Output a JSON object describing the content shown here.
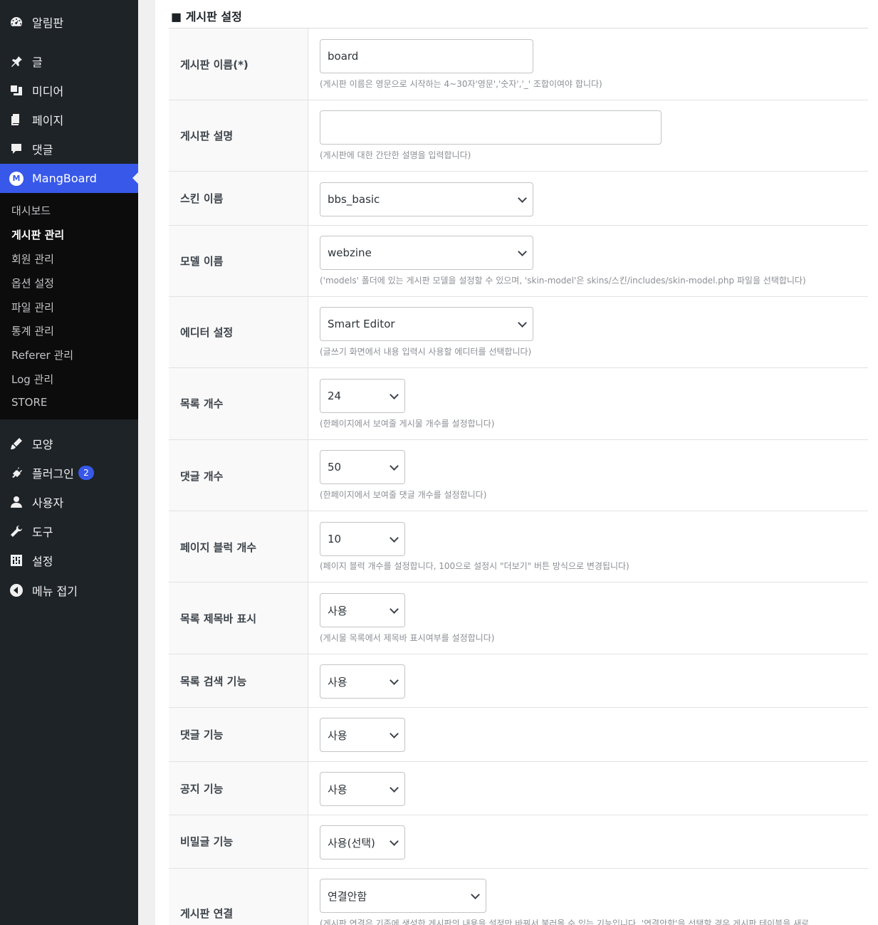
{
  "sidebar": {
    "top_items": [
      {
        "label": "알림판",
        "icon": "dashboard-icon"
      },
      {
        "label": "글",
        "icon": "pin-icon"
      },
      {
        "label": "미디어",
        "icon": "media-icon"
      },
      {
        "label": "페이지",
        "icon": "pages-icon"
      },
      {
        "label": "댓글",
        "icon": "comments-icon"
      },
      {
        "label": "MangBoard",
        "icon": "mangboard-logo-icon"
      }
    ],
    "submenu": [
      "대시보드",
      "게시판 관리",
      "회원 관리",
      "옵션 설정",
      "파일 관리",
      "통계 관리",
      "Referer 관리",
      "Log 관리",
      "STORE"
    ],
    "bottom_items": [
      {
        "label": "모양",
        "icon": "brush-icon"
      },
      {
        "label": "플러그인",
        "icon": "plugin-icon",
        "badge": "2"
      },
      {
        "label": "사용자",
        "icon": "user-icon"
      },
      {
        "label": "도구",
        "icon": "wrench-icon"
      },
      {
        "label": "설정",
        "icon": "settings-icon"
      },
      {
        "label": "메뉴 접기",
        "icon": "collapse-icon"
      }
    ],
    "logo_letter": "M",
    "accent": "#3858e9"
  },
  "main": {
    "section_title": "■ 게시판 설정",
    "rows": [
      {
        "label": "게시판 이름(*)",
        "value": "board",
        "help": "(게시판 이름은 영문으로 시작하는 4~30자'영문','숫자','_' 조합이여야 합니다)"
      },
      {
        "label": "게시판 설명",
        "value": "",
        "help": "(게시판에 대한 간단한 설명을 입력합니다)"
      },
      {
        "label": "스킨 이름",
        "value": "bbs_basic",
        "help": ""
      },
      {
        "label": "모델 이름",
        "value": "webzine",
        "help": "('models' 폴더에 있는 게시판 모델을 설정할 수 있으며, 'skin-model'은 skins/스킨/includes/skin-model.php 파일을 선택합니다)"
      },
      {
        "label": "에디터 설정",
        "value": "Smart Editor",
        "help": "(글쓰기 화면에서 내용 입력시 사용할 에디터를 선택합니다)"
      },
      {
        "label": "목록 개수",
        "value": "24",
        "help": "(한페이지에서 보여줄 게시물 개수를 설정합니다)"
      },
      {
        "label": "댓글 개수",
        "value": "50",
        "help": "(한페이지에서 보여줄 댓글 개수를 설정합니다)"
      },
      {
        "label": "페이지 블럭 개수",
        "value": "10",
        "help": "(페이지 블럭 개수를 설정합니다, 100으로 설정시 \"더보기\" 버튼 방식으로 변경됩니다)"
      },
      {
        "label": "목록 제목바 표시",
        "value": "사용",
        "help": "(게시물 목록에서 제목바 표시여부를 설정합니다)"
      },
      {
        "label": "목록 검색 기능",
        "value": "사용",
        "help": ""
      },
      {
        "label": "댓글 기능",
        "value": "사용",
        "help": ""
      },
      {
        "label": "공지 기능",
        "value": "사용",
        "help": ""
      },
      {
        "label": "비밀글 기능",
        "value": "사용(선택)",
        "help": ""
      },
      {
        "label": "게시판 연결",
        "value": "연결안함",
        "help": "(게시판 연결은 기존에 생성한 게시판의 내용을 설정만 바꿔서 불러올 수 있는 기능입니다. '연결안함'을 선택할 경우 게시판 테이블을 새로"
      }
    ]
  }
}
